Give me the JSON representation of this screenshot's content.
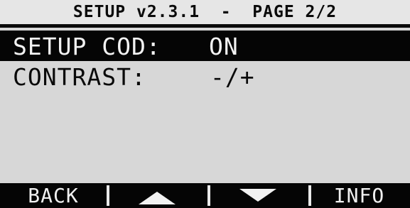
{
  "header": {
    "title": "SETUP v2.3.1  -  PAGE 2/2"
  },
  "menu": {
    "items": [
      {
        "label": "SETUP COD:",
        "value": "ON"
      },
      {
        "label": "CONTRAST:",
        "value": "-/+"
      }
    ]
  },
  "softkeys": {
    "back_label": "BACK",
    "up_icon": "arrow-up-icon",
    "down_icon": "arrow-down-icon",
    "info_label": "INFO"
  },
  "colors": {
    "background": "#d7d7d7",
    "text": "#0a0a0a",
    "selection": "#050505",
    "softkey_text": "#f0f0f0"
  }
}
